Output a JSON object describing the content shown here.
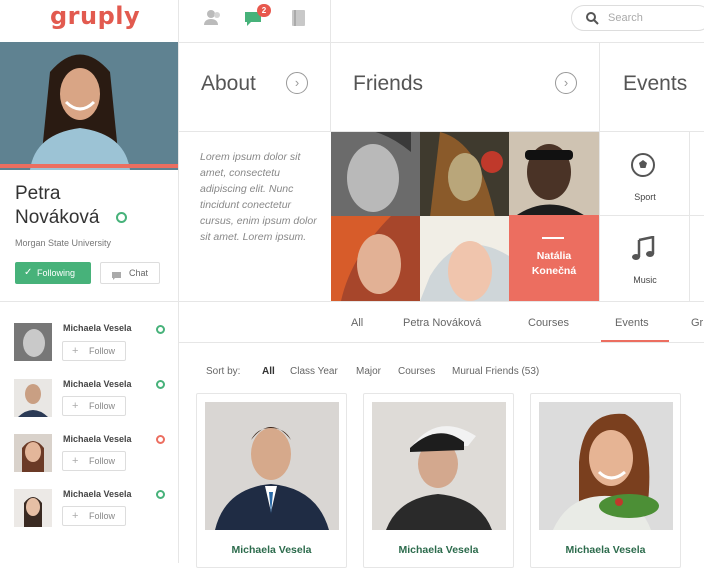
{
  "header": {
    "logo": "gruply",
    "notification_count": "2",
    "search_placeholder": "Search"
  },
  "profile": {
    "first_name": "Petra",
    "last_name": "Nováková",
    "university": "Morgan State University",
    "following_label": "Following",
    "chat_label": "Chat"
  },
  "columns": {
    "about": "About",
    "friends": "Friends",
    "events": "Events"
  },
  "about_text": "Lorem ipsum dolor sit amet, consectetu adipiscing elit. Nunc tincidunt conectetur cursus, enim ipsum dolor sit amet. Lorem ipsum.",
  "featured_friend": {
    "first": "Natália",
    "last": "Konečná"
  },
  "event_categories": [
    "Sport",
    "Music"
  ],
  "suggestions": [
    {
      "name": "Michaela Vesela",
      "follow": "Follow",
      "status": "#47b27a"
    },
    {
      "name": "Michaela Vesela",
      "follow": "Follow",
      "status": "#47b27a"
    },
    {
      "name": "Michaela Vesela",
      "follow": "Follow",
      "status": "#ec6e60"
    },
    {
      "name": "Michaela Vesela",
      "follow": "Follow",
      "status": "#47b27a"
    }
  ],
  "tabs": [
    "All",
    "Petra Nováková",
    "Courses",
    "Events",
    "Gr"
  ],
  "active_tab": "Events",
  "sort": {
    "label": "Sort by:",
    "options": [
      "All",
      "Class Year",
      "Major",
      "Courses",
      "Murual Friends (53)"
    ]
  },
  "cards": [
    {
      "name": "Michaela Vesela"
    },
    {
      "name": "Michaela Vesela"
    },
    {
      "name": "Michaela Vesela"
    }
  ],
  "colors": {
    "brand_green": "#47b27a",
    "accent_red": "#ec6e60"
  }
}
